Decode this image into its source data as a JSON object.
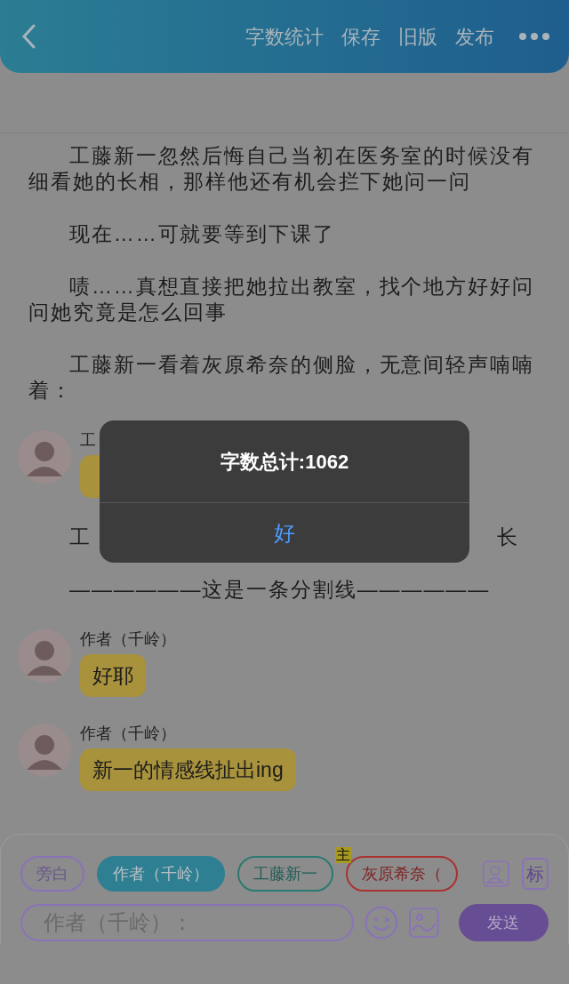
{
  "header": {
    "actions": [
      "字数统计",
      "保存",
      "旧版",
      "发布"
    ]
  },
  "content": [
    {
      "kind": "paragraph",
      "text": "工藤新一忽然后悔自己当初在医务室的时候没有细看她的长相，那样他还有机会拦下她问一问"
    },
    {
      "kind": "paragraph",
      "text": "现在……可就要等到下课了"
    },
    {
      "kind": "paragraph",
      "text": "啧……真想直接把她拉出教室，找个地方好好问问她究竟是怎么回事"
    },
    {
      "kind": "paragraph",
      "text": "工藤新一看着灰原希奈的侧脸，无意间轻声喃喃着："
    },
    {
      "kind": "message",
      "name": "工"
    },
    {
      "kind": "covered",
      "parts": [
        "工",
        "长"
      ]
    },
    {
      "kind": "paragraph",
      "text": "——————这是一条分割线——————"
    },
    {
      "kind": "message",
      "name": "作者（千岭）",
      "text": "好耶"
    },
    {
      "kind": "message",
      "name": "作者（千岭）",
      "text": "新一的情感线扯出ing"
    }
  ],
  "roles": [
    {
      "label": "旁白",
      "selected": false,
      "color": "#8a72b8"
    },
    {
      "label": "作者（千岭）",
      "selected": true,
      "color": "#2e7f92"
    },
    {
      "label": "工藤新一",
      "selected": false,
      "color": "#2a7a70"
    },
    {
      "label": "灰原希奈（",
      "selected": false,
      "color": "#a83232",
      "badge": "主"
    }
  ],
  "mark_button": "标",
  "input": {
    "placeholder": "作者（千岭）："
  },
  "send_button": "发送",
  "dialog": {
    "title": "字数总计:1062",
    "button": "好"
  }
}
